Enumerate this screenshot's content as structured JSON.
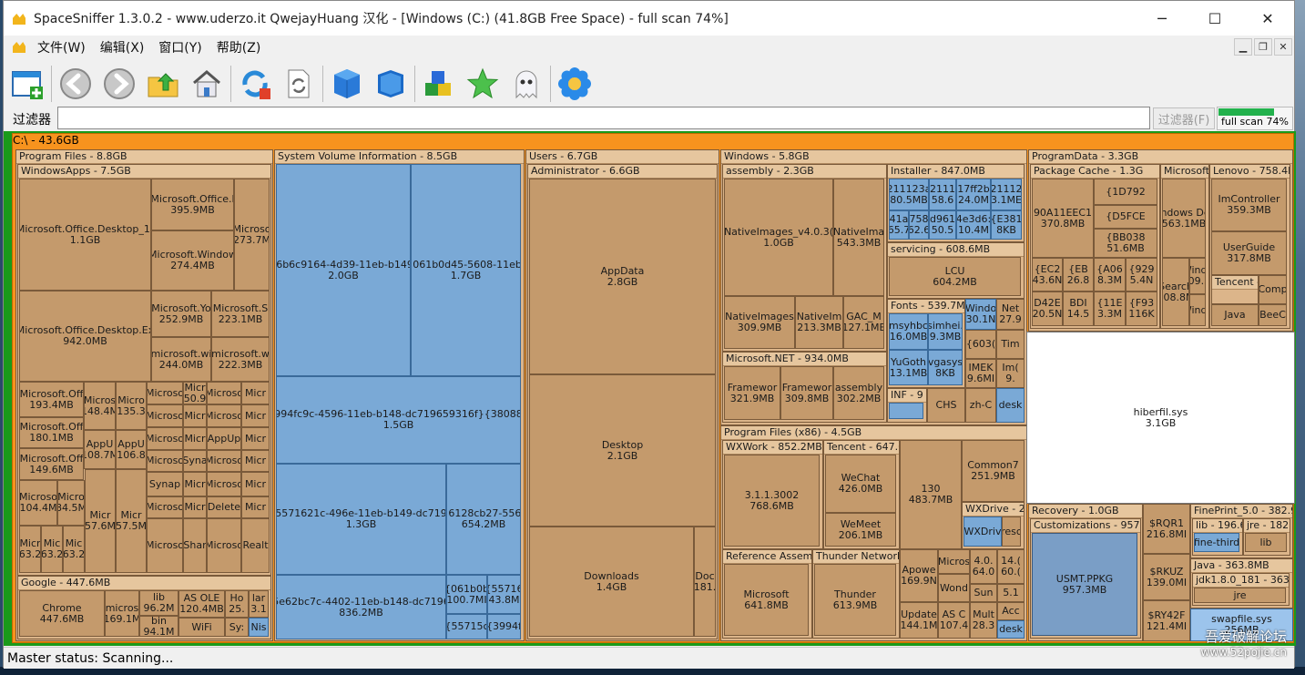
{
  "window": {
    "title": "SpaceSniffer 1.3.0.2 - www.uderzo.it  QwejayHuang 汉化 - [Windows (C:) (41.8GB Free Space) - full scan 74%]",
    "minimize": "─",
    "maximize": "☐",
    "close": "✕"
  },
  "menu": {
    "file": "文件(W)",
    "edit": "编辑(X)",
    "window": "窗口(Y)",
    "help": "帮助(Z)",
    "mdi_min": "▁",
    "mdi_restore": "❐",
    "mdi_close": "✕"
  },
  "filter": {
    "label": "过滤器",
    "value": "",
    "button": "过滤器(F)",
    "progress_text": "full scan 74%",
    "progress": 0.74
  },
  "map": {
    "root": "C:\\ - 43.6GB",
    "program_files": "Program Files - 8.8GB",
    "windowsapps": "WindowsApps - 7.5GB",
    "office1_name": "Microsoft.Office.Desktop_1(",
    "office1_size": "1.1GB",
    "office_l_name": "Microsoft.Office.l",
    "office_l_size": "395.9MB",
    "micro_273_name": "Microso",
    "micro_273_size": "273.7M",
    "office_window_name": "Microsoft.Window",
    "office_window_size": "274.4MB",
    "office_ex_name": "Microsoft.Office.Desktop.Ex",
    "office_ex_size": "942.0MB",
    "msyo_name": "Microsoft.Yo",
    "msyo_size": "252.9MB",
    "mss_name": "Microsoft.S",
    "mss_size": "223.1MB",
    "mswi_name": "microsoft.wi",
    "mswi_size": "244.0MB",
    "msw_name": "microsoft.w",
    "msw_size": "222.3MB",
    "off193_name": "Microsoft.Off",
    "off193_size": "193.4MB",
    "off180_name": "Microsoft.Off",
    "off180_size": "180.1MB",
    "off149_name": "Microsoft.Off",
    "off149_size": "149.6MB",
    "mic148_name": "Micros",
    "mic148_size": "148.4M",
    "mic135_name": "Micro",
    "mic135_size": "135.3",
    "appu108_name": "AppU",
    "appu108_size": "108.7M",
    "appu106_name": "AppU",
    "appu106_size": "106.8",
    "mic104_name": "Microso",
    "mic104_size": "104.4M",
    "mic84_name": "Micro",
    "mic84_size": "84.5M",
    "mic63a": "Micr 63.2",
    "mic63b": "Mic 63.2",
    "mic63c": "Mic 63.2",
    "mic57a": "Micr 57.6M",
    "mic57b": "Micr 57.5M",
    "small_micro": "Microso",
    "small_micr": "Micr",
    "small_50": "50.9",
    "small_uderzo": "Microso",
    "small_syna": "Syna",
    "small_synap": "Synap",
    "small_appu": "AppUp",
    "small_delete": "Delete",
    "small_shar": "Shar",
    "small_realt": "Realt",
    "google": "Google - 447.6MB",
    "chrome_name": "Chrome",
    "chrome_size": "447.6MB",
    "micros169_name": "micros",
    "micros169_size": "169.1M",
    "lib96_name": "lib",
    "lib96_size": "96.2M",
    "bin94_name": "bin",
    "bin94_size": "94.1M",
    "asole_name": "AS OLE",
    "asole_size": "120.4MB",
    "ho25": "Ho 25.",
    "lar31": "lar 3.1",
    "wifi": "WiFi",
    "sys": "Sy:",
    "nis": "Nis",
    "svi": "System Volume Information - 8.5GB",
    "svi1_name": "{6b6c9164-4d39-11eb-b149-",
    "svi1_size": "2.0GB",
    "svi2_name": "{061b0d45-5608-11eb-",
    "svi2_size": "1.7GB",
    "svi3_name": "{3994fc9c-4596-11eb-b148-dc719659316f}{3808876",
    "svi3_size": "1.5GB",
    "svi4_name": "{5571621c-496e-11eb-b149-dc7196",
    "svi4_size": "1.3GB",
    "svi5_name": "{6128cb27-556(",
    "svi5_size": "654.2MB",
    "svi6_name": "{5e62bc7c-4402-11eb-b148-dc71965",
    "svi6_size": "836.2MB",
    "svi7": "{061b0b 100.7MI",
    "svi8": "{55716 43.8M",
    "svi9": "{55715c",
    "svi10": "{3994f",
    "users": "Users - 6.7GB",
    "admin": "Administrator - 6.6GB",
    "appdata_name": "AppData",
    "appdata_size": "2.8GB",
    "desktop_name": "Desktop",
    "desktop_size": "2.1GB",
    "downloads_name": "Downloads",
    "downloads_size": "1.4GB",
    "doc_name": "Doc",
    "doc_size": "181.",
    "windows": "Windows - 5.8GB",
    "assembly": "assembly - 2.3GB",
    "ni4_name": "NativeImages_v4.0.3(",
    "ni4_size": "1.0GB",
    "nima_name": "NativeIma",
    "nima_size": "543.3MB",
    "ni309_name": "NativeImages",
    "ni309_size": "309.9MB",
    "ni213_name": "NativeIm",
    "ni213_size": "213.3MB",
    "gac_name": "GAC_M",
    "gac_size": "127.1ME",
    "installer": "Installer - 847.0MB",
    "inst1": "211123a 80.5MB",
    "inst2": "2111 58.6",
    "inst3": "17ff2b 24.0M",
    "inst4": "21112 3.1ME",
    "inst5": "41a 65.7",
    "inst6": "758 62.6",
    "inst7": "d961 50.5",
    "inst8": "4e3d6: 10.4M",
    "inst9": "{E381 8KB",
    "servicing": "servicing - 608.6MB",
    "lcu_name": "LCU",
    "lcu_size": "604.2MB",
    "fonts": "Fonts - 539.7MB",
    "msyh": "msyhbc 16.0MB",
    "simhei": "simhei. 9.3MB",
    "yugoth": "YuGoth 13.1MB",
    "vgasys": "vgasys 8KB",
    "wind30": "Windo 30.1N",
    "net27": "Net 27.9",
    "f603": "{603(",
    "time": "Tim",
    "imek": "IMEK 9.6MI",
    "imc": "Im( 9.",
    "inf": "INF - 9",
    "chs": "CHS",
    "zhc": "zh-C",
    "desk": "desk",
    "dotnet": "Microsoft.NET - 934.0MB",
    "fw321": "Framewor 321.9MB",
    "fw309": "Framewor 309.8MB",
    "asm302": "assembly 302.2MB",
    "pf86": "Program Files (x86) - 4.5GB",
    "wxwork": "WXWork - 852.2MB",
    "wxwork_ver_name": "3.1.1.3002",
    "wxwork_ver_size": "768.6MB",
    "tencent": "Tencent - 647.6",
    "wechat_name": "WeChat",
    "wechat_size": "426.0MB",
    "wemeet_name": "WeMeet",
    "wemeet_size": "206.1MB",
    "v130_name": "130",
    "v130_size": "483.7MB",
    "common7_name": "Common7",
    "common7_size": "251.9MB",
    "wxdrive": "WXDrive - 20",
    "wxdriv_inner": "WXDriv",
    "resc": "resc",
    "refasm": "Reference Assemb",
    "refasm_ms_name": "Microsoft",
    "refasm_ms_size": "641.8MB",
    "thundernet": "Thunder Network",
    "thunder_name": "Thunder",
    "thunder_size": "613.9MB",
    "apow": "Apowe 169.9N",
    "micros2": "Micros",
    "wond": "Wond",
    "v40": "4.0. 64.0",
    "v14": "14.( 60.(",
    "sun": "Sun",
    "v51": "5.1",
    "update": "Update 144.1M",
    "asc": "AS C 107.4",
    "mult": "Mult 28.3",
    "acc": "Acc",
    "desk2": "desk",
    "programdata": "ProgramData - 3.3GB",
    "pkgcache": "Package Cache - 1.3G",
    "pc90_name": "90A11EEC1",
    "pc90_size": "370.8MB",
    "pc1d": "{1D792",
    "pcd5": "{D5FCE",
    "pcbb": "{BB038 51.6MB",
    "pcec2": "{EC2 43.6N",
    "pceb": "{EB 26.8",
    "pca06": "{A06 8.3M",
    "pc929": "{929 5.4N",
    "pcd42": "D42E 20.5N",
    "pcbd": "BDI 14.5",
    "pc11e": "{11E 3.3M",
    "pcf9": "{F93 116K",
    "msft": "Microsoft - 961",
    "wdef_name": "Windows Defe",
    "wdef_size": "563.1MB",
    "search": "Search 208.8M",
    "wind109": "Windo 109.5I",
    "wind3": "Windo",
    "lenovo": "Lenovo - 758.4M",
    "imc_name": "ImController",
    "imc_size": "359.3MB",
    "ug_name": "UserGuide",
    "ug_size": "317.8MB",
    "tencent2": "Tencent -",
    "comp": "Comp",
    "java": "Java",
    "beec": "BeeC",
    "hiberfil_name": "hiberfil.sys",
    "hiberfil_size": "3.1GB",
    "recovery": "Recovery - 1.0GB",
    "custom": "Customizations - 957.3",
    "usmt_name": "USMT.PPKG",
    "usmt_size": "957.3MB",
    "srqr": "$RQR1 216.8MI",
    "srku": "$RKUZ 139.0MI",
    "sry4": "$RY42F 121.4MI",
    "fineprint": "FinePrint_5.0 - 382.9",
    "lib196": "lib - 196.6",
    "jre182": "jre - 182.",
    "finethird": "fine-third",
    "lib2": "lib",
    "java363": "Java - 363.8MB",
    "jdk": "jdk1.8.0_181 - 363.",
    "jre2": "jre",
    "swap_name": "swapfile.sys",
    "swap_size": "256MB"
  },
  "status": {
    "text": "Master status: Scanning...",
    "watermark1": "吾爱破解论坛",
    "watermark2": "www.52pojie.cn"
  },
  "colors": {
    "root": "#f7931e",
    "folder": "#dcb58a",
    "file": "#c49a6c",
    "system": "#7aa9d6",
    "progress": "#22b14c"
  }
}
